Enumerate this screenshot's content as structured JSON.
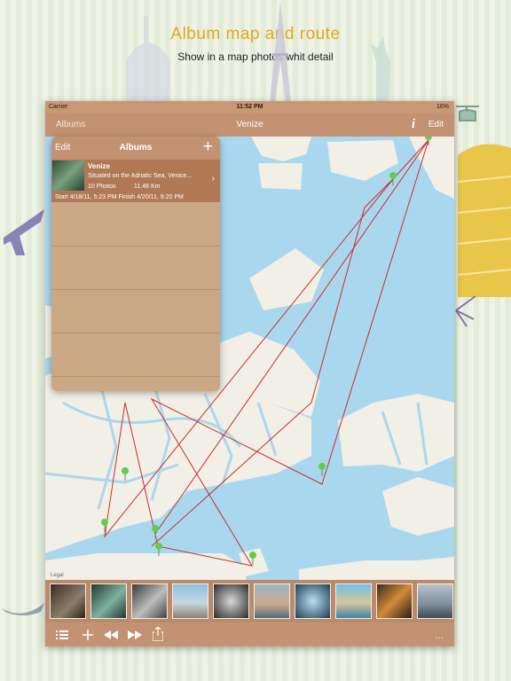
{
  "poster": {
    "headline": "Album map and route",
    "subline": "Show in a map photos whit detail"
  },
  "statusbar": {
    "carrier": "Carrier",
    "time": "11:52 PM",
    "battery": "16%"
  },
  "navbar": {
    "back_label": "Albums",
    "title": "Venize",
    "info_label": "i",
    "edit_label": "Edit"
  },
  "popover": {
    "edit_label": "Edit",
    "title": "Albums",
    "add_label": "+",
    "albums": [
      {
        "name": "Venize",
        "description": "Situated on the Adriatic Sea, Venice...",
        "photos": "10 Photos",
        "distance": "11.48 Km",
        "dates": "Start 4/18/11, 5:23 PM Finish 4/20/11, 9:20 PM"
      }
    ]
  },
  "map": {
    "legal_label": "Legal"
  },
  "photostrip": {
    "count": 10
  },
  "toolbar": {
    "list_icon": "list-icon",
    "add_icon": "plus-icon",
    "rewind_icon": "rewind-icon",
    "forward_icon": "fast-forward-icon",
    "share_icon": "share-icon"
  },
  "colors": {
    "accent": "#c39272",
    "headline": "#e6a51a",
    "water": "#a9d8ee",
    "land": "#f2efe6",
    "route": "#cc2b2b",
    "pin": "#5fcf4a"
  }
}
